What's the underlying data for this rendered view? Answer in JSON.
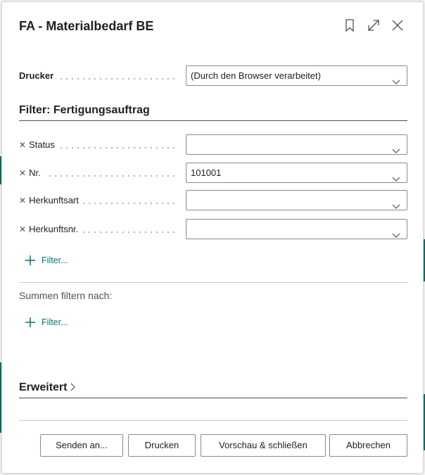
{
  "dialog": {
    "title": "FA - Materialbedarf BE"
  },
  "printer": {
    "label": "Drucker",
    "value": "(Durch den Browser verarbeitet)"
  },
  "filter_section": {
    "title": "Filter: Fertigungsauftrag",
    "fields": [
      {
        "label": "Status",
        "value": ""
      },
      {
        "label": "Nr.",
        "value": "101001"
      },
      {
        "label": "Herkunftsart",
        "value": ""
      },
      {
        "label": "Herkunftsnr.",
        "value": ""
      }
    ],
    "add_filter_label": "Filter..."
  },
  "totals_section": {
    "title": "Summen filtern nach:",
    "add_filter_label": "Filter..."
  },
  "advanced": {
    "title": "Erweitert"
  },
  "buttons": {
    "send": "Senden an...",
    "print": "Drucken",
    "preview": "Vorschau & schließen",
    "cancel": "Abbrechen"
  },
  "icons": [
    "bookmark-icon",
    "expand-icon",
    "close-icon",
    "chevron-down-icon",
    "remove-filter-icon",
    "plus-icon",
    "chevron-right-icon"
  ],
  "colors": {
    "accent": "#00766f",
    "text": "#212121",
    "border": "#8a8a8a"
  }
}
